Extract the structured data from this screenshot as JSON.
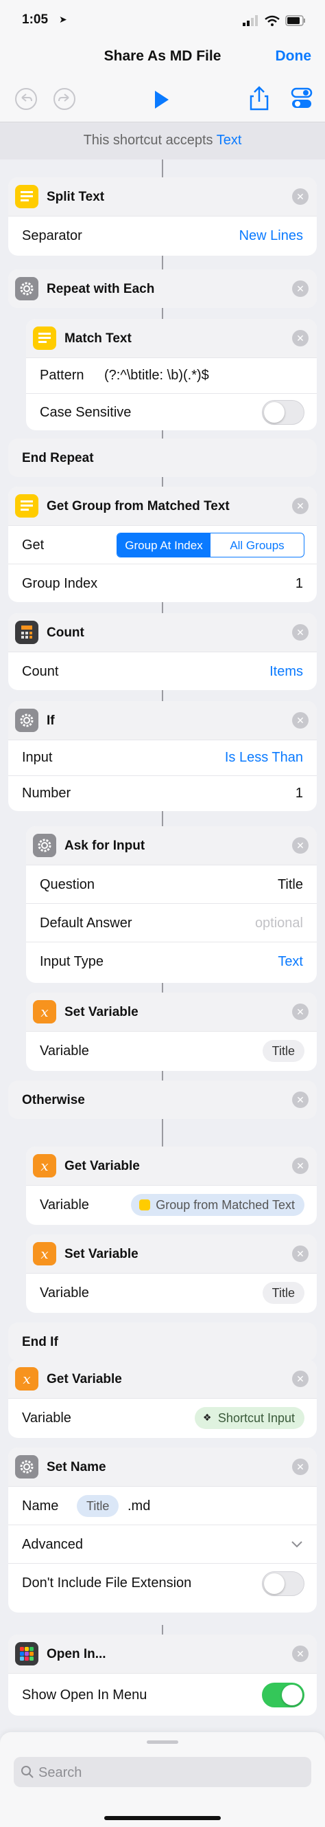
{
  "status_bar": {
    "time": "1:05"
  },
  "nav": {
    "title": "Share As MD File",
    "done": "Done"
  },
  "accepts": {
    "prefix": "This shortcut accepts",
    "type": "Text"
  },
  "actions": {
    "split_text": {
      "title": "Split Text",
      "separator_label": "Separator",
      "separator_value": "New Lines"
    },
    "repeat": {
      "title": "Repeat with Each",
      "end": "End Repeat"
    },
    "match_text": {
      "title": "Match Text",
      "pattern_label": "Pattern",
      "pattern_value": "(?:^\\btitle: \\b)(.*)$",
      "case_label": "Case Sensitive"
    },
    "get_group": {
      "title": "Get Group from Matched Text",
      "get_label": "Get",
      "seg_at_index": "Group At Index",
      "seg_all": "All Groups",
      "index_label": "Group Index",
      "index_value": "1"
    },
    "count": {
      "title": "Count",
      "label": "Count",
      "value": "Items"
    },
    "if": {
      "title": "If",
      "input_label": "Input",
      "input_value": "Is Less Than",
      "number_label": "Number",
      "number_value": "1",
      "otherwise": "Otherwise",
      "end": "End If"
    },
    "ask_input": {
      "title": "Ask for Input",
      "question_label": "Question",
      "question_value": "Title",
      "default_label": "Default Answer",
      "default_placeholder": "optional",
      "type_label": "Input Type",
      "type_value": "Text"
    },
    "set_var_1": {
      "title": "Set Variable",
      "label": "Variable",
      "value": "Title"
    },
    "get_var_1": {
      "title": "Get Variable",
      "label": "Variable",
      "value": "Group from Matched Text"
    },
    "set_var_2": {
      "title": "Set Variable",
      "label": "Variable",
      "value": "Title"
    },
    "get_var_2": {
      "title": "Get Variable",
      "label": "Variable",
      "value": "Shortcut Input"
    },
    "set_name": {
      "title": "Set Name",
      "name_label": "Name",
      "name_token": "Title",
      "name_suffix": ".md",
      "advanced": "Advanced",
      "ext_label": "Don't Include File Extension"
    },
    "open_in": {
      "title": "Open In...",
      "menu_label": "Show Open In Menu"
    }
  },
  "search": {
    "placeholder": "Search"
  },
  "colors": {
    "accent": "#0a7aff",
    "toggle_on": "#34c759",
    "variable_orange": "#f7931e",
    "text_yellow": "#ffcc00",
    "settings_grey": "#8e8e93"
  }
}
